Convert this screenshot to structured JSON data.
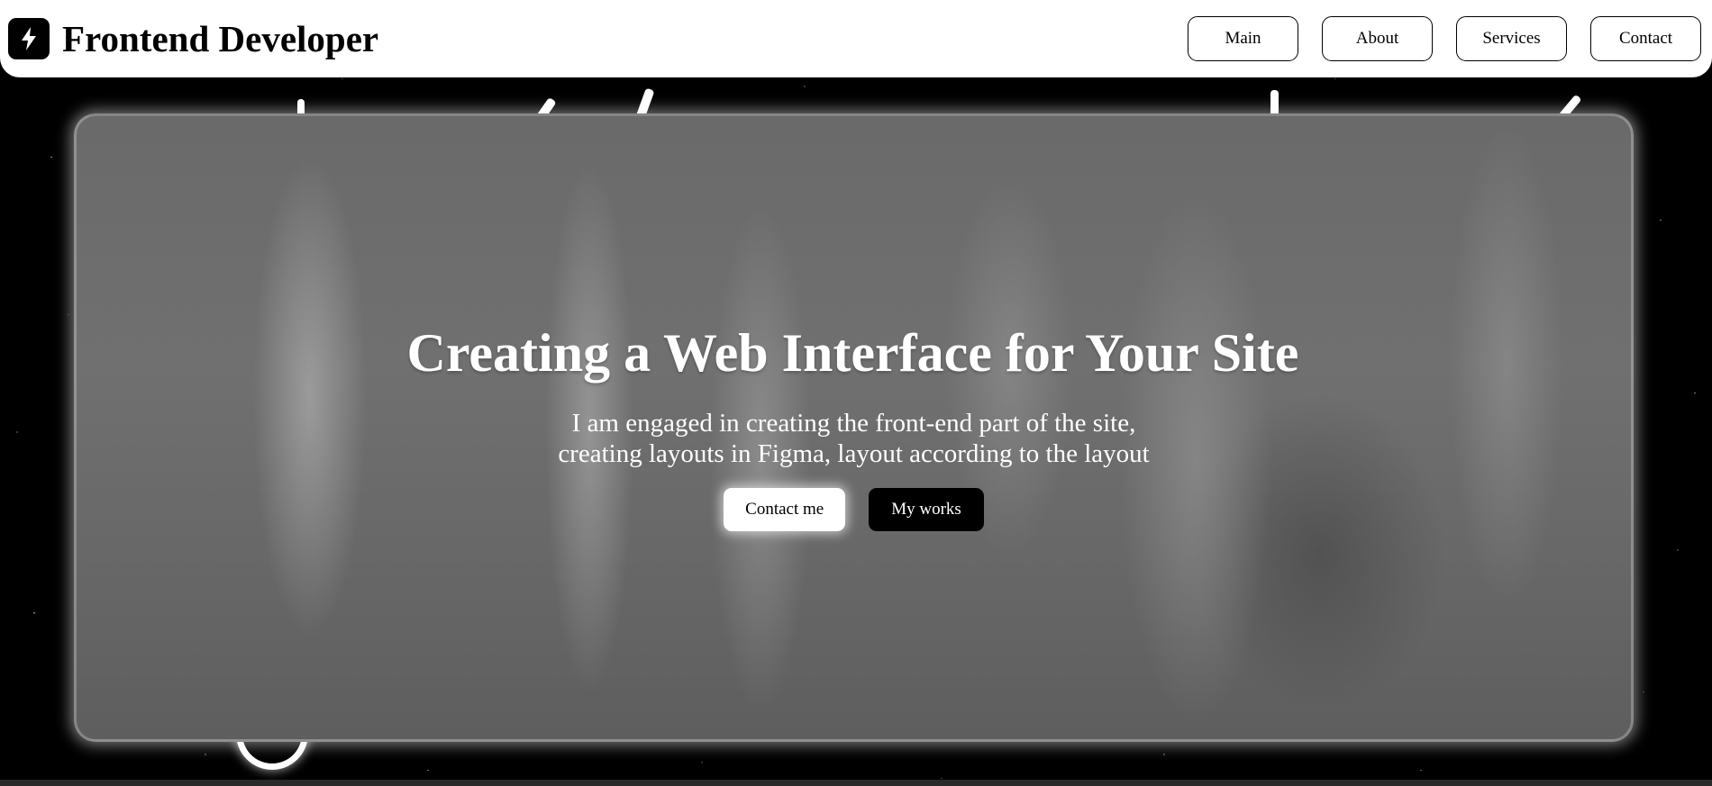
{
  "header": {
    "brand_title": "Frontend Developer",
    "logo_icon": "lightning-icon",
    "nav": [
      {
        "label": "Main"
      },
      {
        "label": "About"
      },
      {
        "label": "Services"
      },
      {
        "label": "Contact"
      }
    ]
  },
  "hero": {
    "title": "Creating a Web Interface for Your Site",
    "subtitle_line1": "I am engaged in creating the front-end part of the site,",
    "subtitle_line2": "creating layouts in Figma, layout according to the layout",
    "primary_button": "Contact me",
    "secondary_button": "My works"
  },
  "colors": {
    "background": "#000000",
    "header": "#ffffff",
    "card": "#6a6a6a",
    "text_light": "#ffffff"
  }
}
